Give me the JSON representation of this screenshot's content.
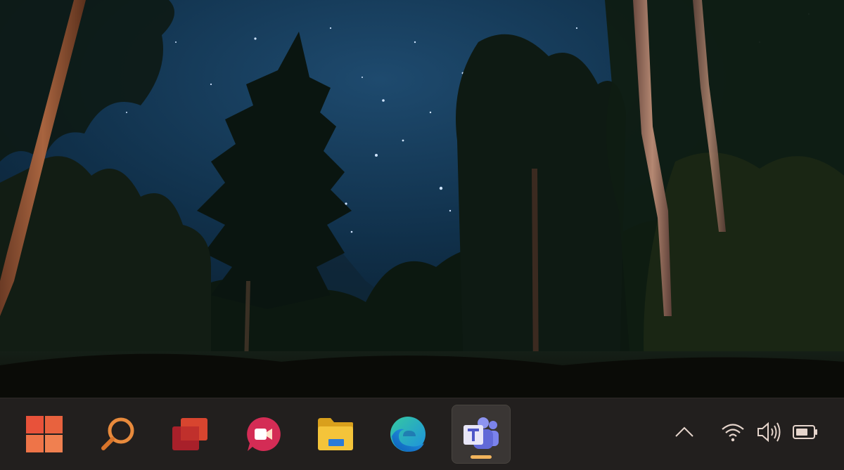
{
  "desktop": {
    "wallpaper": "night-forest-starry-sky"
  },
  "taskbar": {
    "background": "#221f1e",
    "accent": "#f2b45c",
    "apps": [
      {
        "id": "start",
        "icon": "windows-start-icon",
        "pinned": true,
        "active": false
      },
      {
        "id": "search",
        "icon": "search-icon",
        "pinned": true,
        "active": false
      },
      {
        "id": "task-view",
        "icon": "task-view-icon",
        "pinned": true,
        "active": false
      },
      {
        "id": "chat",
        "icon": "video-chat-icon",
        "pinned": true,
        "active": false
      },
      {
        "id": "file-explorer",
        "icon": "file-explorer-icon",
        "pinned": true,
        "active": false
      },
      {
        "id": "edge",
        "icon": "edge-browser-icon",
        "pinned": true,
        "active": false
      },
      {
        "id": "teams",
        "icon": "teams-icon",
        "pinned": true,
        "active": true
      }
    ],
    "tray": [
      {
        "id": "show-hidden",
        "icon": "chevron-up-icon"
      },
      {
        "id": "network",
        "icon": "wifi-icon"
      },
      {
        "id": "volume",
        "icon": "speaker-icon"
      },
      {
        "id": "battery",
        "icon": "battery-icon"
      }
    ]
  }
}
